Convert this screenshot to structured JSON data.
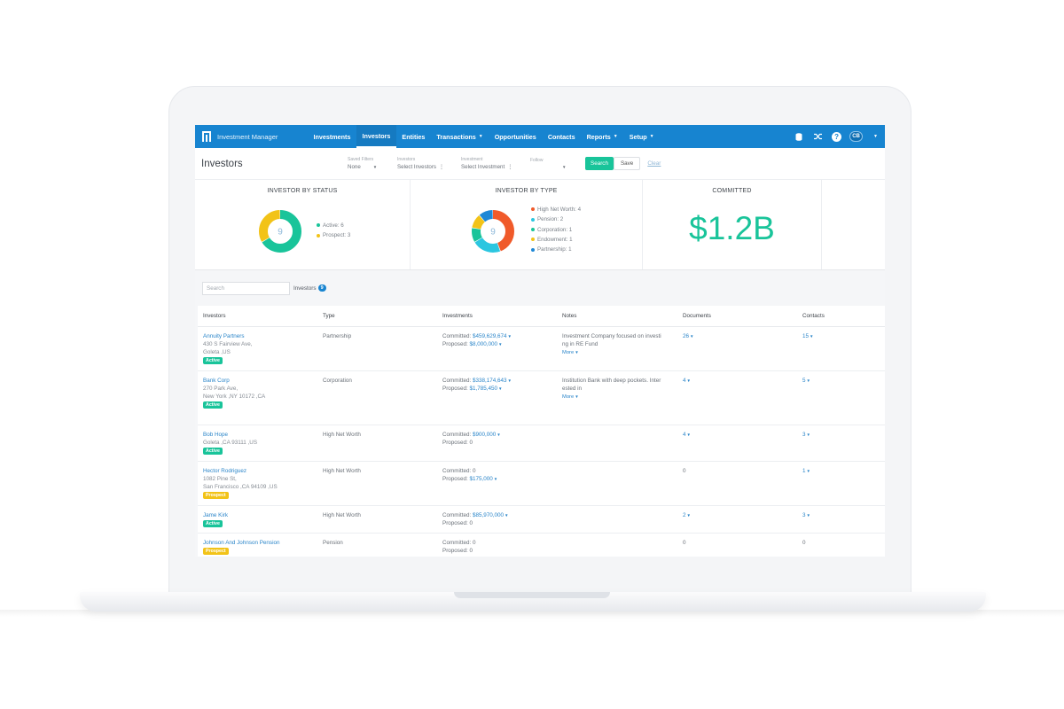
{
  "colors": {
    "nav": "#1784d0",
    "accent": "#19c49a",
    "prospect": "#f2c318",
    "link": "#2a85c9"
  },
  "app": {
    "name": "Investment Manager",
    "logo_icon": "building-columns-icon"
  },
  "nav": {
    "items": [
      {
        "label": "Investments",
        "active": false,
        "caret": false
      },
      {
        "label": "Investors",
        "active": true,
        "caret": false
      },
      {
        "label": "Entities",
        "active": false,
        "caret": false
      },
      {
        "label": "Transactions",
        "active": false,
        "caret": true
      },
      {
        "label": "Opportunities",
        "active": false,
        "caret": false
      },
      {
        "label": "Contacts",
        "active": false,
        "caret": false
      },
      {
        "label": "Reports",
        "active": false,
        "caret": true
      },
      {
        "label": "Setup",
        "active": false,
        "caret": true
      }
    ],
    "user_initials": "CB"
  },
  "toolbar": {
    "title": "Investors",
    "filters": [
      {
        "label": "Saved Filters",
        "value": "None"
      },
      {
        "label": "Investors",
        "value": "Select Investors"
      },
      {
        "label": "Investment",
        "value": "Select Investment"
      },
      {
        "label": "Follow",
        "value": ""
      }
    ],
    "search_label": "Search",
    "save_label": "Save",
    "clear_label": "Clear"
  },
  "stats": {
    "status": {
      "title": "INVESTOR BY STATUS",
      "total": "9",
      "items": [
        {
          "label": "Active: 6",
          "value": 6,
          "color": "#19c49a"
        },
        {
          "label": "Prospect: 3",
          "value": 3,
          "color": "#f2c318"
        }
      ]
    },
    "type": {
      "title": "INVESTOR BY TYPE",
      "total": "9",
      "items": [
        {
          "label": "High Net Worth: 4",
          "value": 4,
          "color": "#f05a2a"
        },
        {
          "label": "Pension: 2",
          "value": 2,
          "color": "#2bc6e0"
        },
        {
          "label": "Corporation: 1",
          "value": 1,
          "color": "#19c49a"
        },
        {
          "label": "Endowment: 1",
          "value": 1,
          "color": "#f2c318"
        },
        {
          "label": "Partnership: 1",
          "value": 1,
          "color": "#1e88d6"
        }
      ]
    },
    "committed": {
      "title": "COMMITTED",
      "value": "$1.2B"
    }
  },
  "table": {
    "search_placeholder": "Search",
    "count_label": "Investors",
    "count": "9",
    "columns": [
      "Investors",
      "Type",
      "Investments",
      "Notes",
      "Documents",
      "Contacts"
    ],
    "rows": [
      {
        "name": "Annuity Partners",
        "address": [
          "430 S Fairview Ave,",
          "Goleta ,US"
        ],
        "status": "Active",
        "type": "Partnership",
        "committed": "$459,629,674",
        "proposed": "$8,000,000",
        "notes": [
          "Investment Company focused on investi",
          "ng in RE Fund"
        ],
        "more": "More",
        "documents": "26",
        "contacts": "15"
      },
      {
        "name": "Bank Corp",
        "address": [
          "270 Park Ave,",
          "New York ,NY 10172 ,CA"
        ],
        "status": "Active",
        "type": "Corporation",
        "committed": "$338,174,643",
        "proposed": "$1,785,450",
        "notes": [
          "Institution Bank with deep pockets. Inter",
          "ested in"
        ],
        "more": "More",
        "documents": "4",
        "contacts": "5"
      },
      {
        "name": "Bob Hope",
        "address": [
          "Goleta ,CA 93111 ,US"
        ],
        "status": "Active",
        "type": "High Net Worth",
        "committed": "$900,000",
        "proposed": "0",
        "notes": [],
        "more": "",
        "documents": "4",
        "contacts": "3"
      },
      {
        "name": "Hector Rodriguez",
        "address": [
          "1082 Pine St,",
          "San Francisco ,CA 94109 ,US"
        ],
        "status": "Prospect",
        "type": "High Net Worth",
        "committed": "0",
        "proposed": "$175,000",
        "notes": [],
        "more": "",
        "documents": "0",
        "contacts": "1"
      },
      {
        "name": "Jame Kirk",
        "address": [],
        "status": "Active",
        "type": "High Net Worth",
        "committed": "$85,970,000",
        "proposed": "0",
        "notes": [],
        "more": "",
        "documents": "2",
        "contacts": "3"
      },
      {
        "name": "Johnson And Johnson Pension",
        "address": [],
        "status": "Prospect",
        "type": "Pension",
        "committed": "0",
        "proposed": "0",
        "notes": [],
        "more": "",
        "documents": "0",
        "contacts": "0"
      }
    ],
    "committed_prefix": "Committed: ",
    "proposed_prefix": "Proposed: "
  }
}
